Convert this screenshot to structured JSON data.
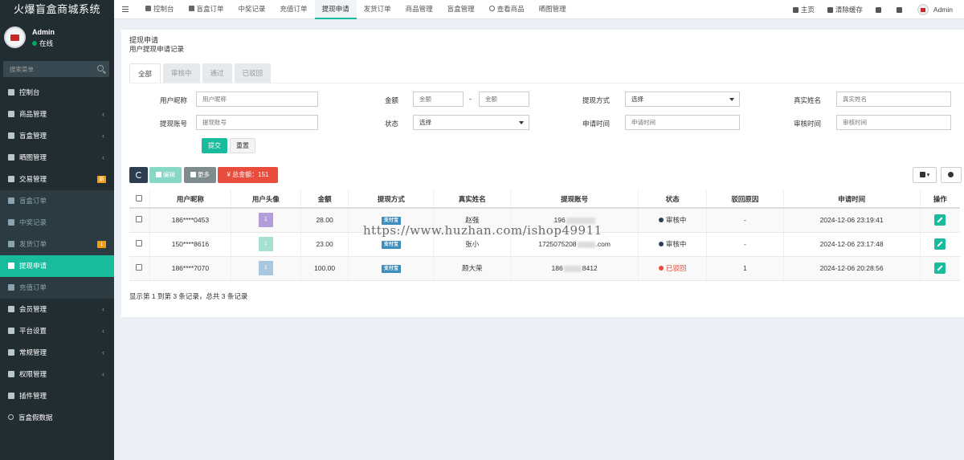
{
  "app": {
    "title": "火爆盲盒商城系统"
  },
  "user": {
    "name": "Admin",
    "status": "在线"
  },
  "sidebar": {
    "search_placeholder": "搜索菜单",
    "items": [
      {
        "label": "控制台",
        "icon": "dashboard-icon"
      },
      {
        "label": "商品管理",
        "icon": "box-icon",
        "chevron": "‹"
      },
      {
        "label": "盲盒管理",
        "icon": "gift-icon",
        "chevron": "‹"
      },
      {
        "label": "晒图管理",
        "icon": "gift-icon",
        "chevron": "‹"
      },
      {
        "label": "交易管理",
        "icon": "cart-icon",
        "badge": "新"
      },
      {
        "label": "盲盒订单",
        "icon": "calendar-icon",
        "sub": true
      },
      {
        "label": "中奖记录",
        "icon": "trophy-icon",
        "sub": true
      },
      {
        "label": "发货订单",
        "icon": "file-icon",
        "sub": true,
        "badge": "1"
      },
      {
        "label": "提现申请",
        "icon": "withdraw-icon",
        "active": true
      },
      {
        "label": "充值订单",
        "icon": "card-icon",
        "sub": true
      },
      {
        "label": "会员管理",
        "icon": "user-icon",
        "chevron": "‹"
      },
      {
        "label": "平台设置",
        "icon": "cogs-icon",
        "chevron": "‹"
      },
      {
        "label": "常规管理",
        "icon": "cogs-icon",
        "chevron": "‹"
      },
      {
        "label": "权限管理",
        "icon": "group-icon",
        "chevron": "‹"
      },
      {
        "label": "插件管理",
        "icon": "rocket-icon"
      },
      {
        "label": "盲盒假数据",
        "icon": "circle-icon"
      }
    ]
  },
  "topnav": {
    "tabs": [
      {
        "label": "控制台",
        "icon": "dashboard-icon"
      },
      {
        "label": "盲盒订单",
        "icon": "calendar-icon"
      },
      {
        "label": "中奖记录"
      },
      {
        "label": "充值订单"
      },
      {
        "label": "提现申请",
        "active": true
      },
      {
        "label": "发货订单"
      },
      {
        "label": "商品管理"
      },
      {
        "label": "盲盒管理"
      },
      {
        "label": "查看商品",
        "icon": "circle-icon"
      },
      {
        "label": "晒图管理"
      }
    ],
    "right": {
      "home": "主页",
      "clear_cache": "清除缓存",
      "admin": "Admin"
    }
  },
  "page": {
    "title": "提现申请",
    "subtitle": "用户提现申请记录",
    "filter_tabs": [
      "全部",
      "审核中",
      "通过",
      "已驳回"
    ]
  },
  "filters": {
    "nickname_label": "用户昵称",
    "nickname_placeholder": "用户昵称",
    "amount_label": "金额",
    "amount_min_placeholder": "金额",
    "amount_sep": "-",
    "amount_max_placeholder": "金额",
    "method_label": "提现方式",
    "method_value": "选择",
    "realname_label": "真实姓名",
    "realname_placeholder": "真实姓名",
    "account_label": "提现账号",
    "account_placeholder": "提现账号",
    "status_label": "状态",
    "status_value": "选择",
    "apply_time_label": "申请时间",
    "apply_time_placeholder": "申请时间",
    "review_time_label": "审核时间",
    "review_time_placeholder": "审核时间",
    "submit": "提交",
    "reset": "重置"
  },
  "toolbar": {
    "edit": "编辑",
    "more": "更多",
    "total": "¥ 总金额：151"
  },
  "table": {
    "columns": [
      "用户昵称",
      "用户头像",
      "金额",
      "提现方式",
      "真实姓名",
      "提现账号",
      "状态",
      "驳回原因",
      "申请时间",
      "操作"
    ],
    "rows": [
      {
        "nickname": "186****0453",
        "avatar": "1",
        "avatar_color": "#b39ddb",
        "amount": "28.00",
        "method": "支付宝",
        "realname": "赵强",
        "account": "196",
        "status": "审核中",
        "status_color": "#2c3e50",
        "reject": "-",
        "time": "2024-12-06 23:19:41"
      },
      {
        "nickname": "150****8616",
        "avatar": "1",
        "avatar_color": "#a5e0d0",
        "amount": "23.00",
        "method": "支付宝",
        "realname": "张小",
        "account": "1725075208",
        "account_tail": ".com",
        "status": "审核中",
        "status_color": "#2c3e50",
        "reject": "-",
        "time": "2024-12-06 23:17:48"
      },
      {
        "nickname": "186****7070",
        "avatar": "1",
        "avatar_color": "#a8c8e0",
        "amount": "100.00",
        "method": "支付宝",
        "realname": "顾大荣",
        "account": "186",
        "account_tail": "8412",
        "status": "已驳回",
        "status_color": "#e74c3c",
        "reject": "1",
        "time": "2024-12-06 20:28:56"
      }
    ],
    "summary": "显示第 1 到第 3 条记录，总共 3 条记录"
  },
  "watermark": "https://www.huzhan.com/ishop49911"
}
